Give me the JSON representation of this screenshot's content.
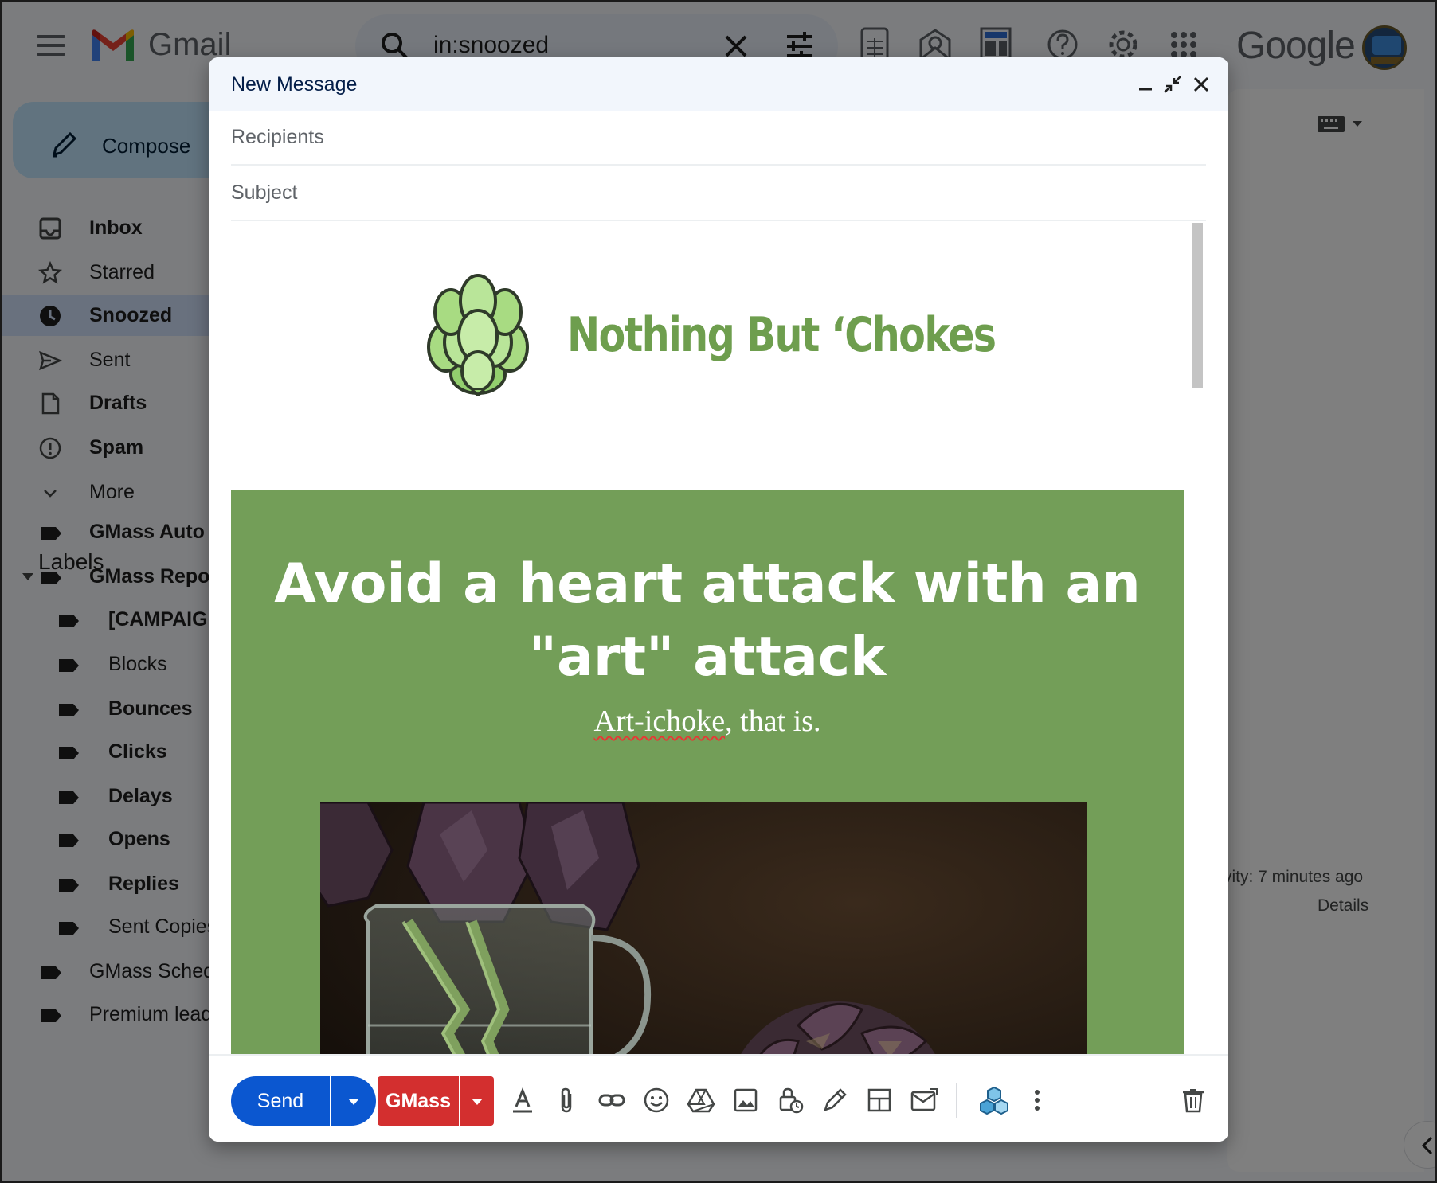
{
  "gmail": {
    "logo_text": "Gmail",
    "search_query": "in:snoozed",
    "brand": "Google",
    "compose_label": "Compose",
    "nav": [
      {
        "label": "Inbox",
        "icon": "inbox-icon",
        "bold": true
      },
      {
        "label": "Starred",
        "icon": "star-icon",
        "bold": false
      },
      {
        "label": "Snoozed",
        "icon": "clock-icon",
        "bold": true,
        "active": true
      },
      {
        "label": "Sent",
        "icon": "send-icon",
        "bold": false
      },
      {
        "label": "Drafts",
        "icon": "draft-icon",
        "bold": true
      },
      {
        "label": "Spam",
        "icon": "spam-icon",
        "bold": true
      },
      {
        "label": "More",
        "icon": "chevron-down-icon",
        "bold": false
      }
    ],
    "labels_header": "Labels",
    "labels": [
      {
        "label": "GMass Auto",
        "bold": true
      },
      {
        "label": "GMass Repo",
        "bold": true
      },
      {
        "label": "[CAMPAIG",
        "bold": true
      },
      {
        "label": "Blocks",
        "bold": false
      },
      {
        "label": "Bounces",
        "bold": true
      },
      {
        "label": "Clicks",
        "bold": true
      },
      {
        "label": "Delays",
        "bold": true
      },
      {
        "label": "Opens",
        "bold": true
      },
      {
        "label": "Replies",
        "bold": true
      },
      {
        "label": "Sent Copies",
        "bold": false
      },
      {
        "label": "GMass Sched",
        "bold": false
      },
      {
        "label": "Premium lead",
        "bold": false
      }
    ],
    "activity_text": "vity: 7 minutes ago",
    "details_text": "Details"
  },
  "compose": {
    "title": "New Message",
    "recipients_placeholder": "Recipients",
    "subject_placeholder": "Subject",
    "send_label": "Send",
    "gmass_label": "GMass"
  },
  "email": {
    "brand_name": "Nothing But ‘Chokes",
    "hero_title": "Avoid a heart attack with an \"art\" attack",
    "hero_sub_word": "Art-ichoke",
    "hero_sub_rest": ", that is.",
    "brand_color": "#6e9e4e",
    "hero_bg": "#739e58"
  },
  "colors": {
    "send_blue": "#0b57d0",
    "gmass_red": "#d32f2f",
    "compose_head_bg": "#f2f6fc"
  }
}
